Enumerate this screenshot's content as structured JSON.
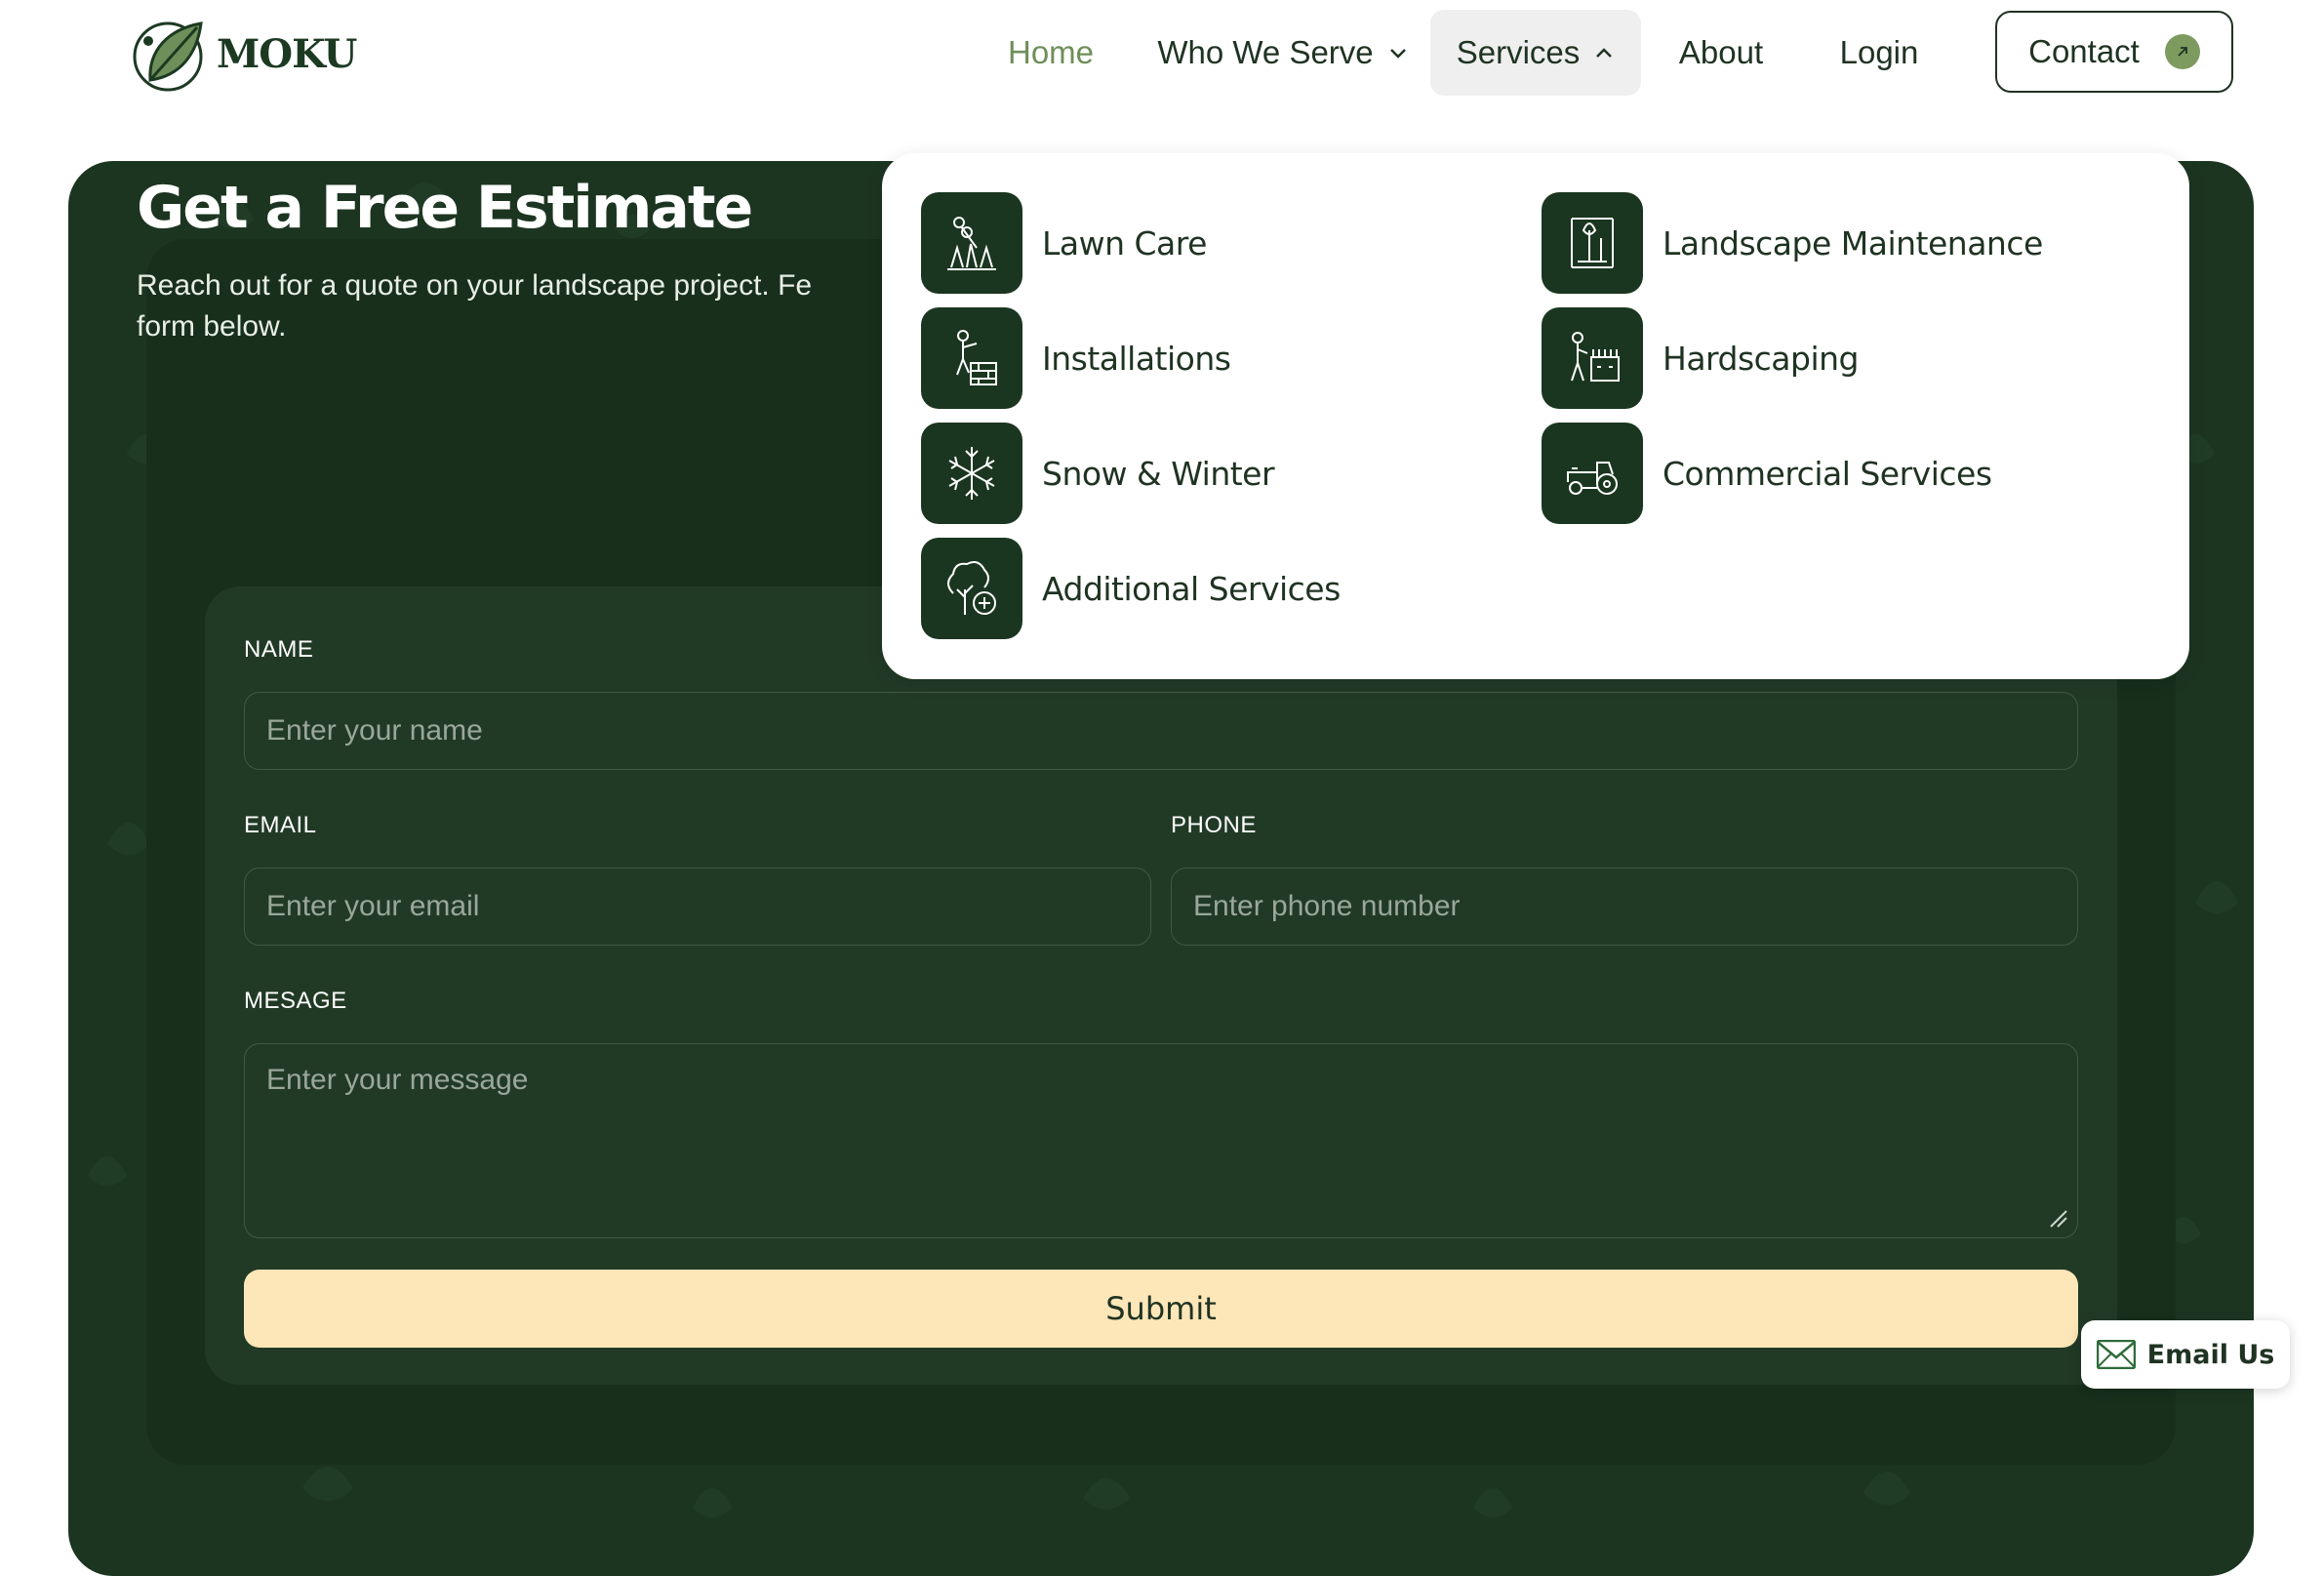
{
  "brand": {
    "name": "MOKU"
  },
  "nav": {
    "home": "Home",
    "who_we_serve": "Who We Serve",
    "services": "Services",
    "about": "About",
    "login": "Login",
    "contact": "Contact"
  },
  "services_menu": {
    "items": [
      {
        "label": "Lawn Care",
        "icon": "lawn-care-icon"
      },
      {
        "label": "Landscape Maintenance",
        "icon": "landscape-maintenance-icon"
      },
      {
        "label": "Installations",
        "icon": "installations-icon"
      },
      {
        "label": "Hardscaping",
        "icon": "hardscaping-icon"
      },
      {
        "label": "Snow & Winter",
        "icon": "snowflake-icon"
      },
      {
        "label": "Commercial Services",
        "icon": "tractor-icon"
      },
      {
        "label": "Additional Services",
        "icon": "tree-plus-icon"
      }
    ]
  },
  "estimate": {
    "title": "Get a Free Estimate",
    "subtitle": "Reach out for a quote on your landscape project. Fe",
    "subtitle_line2": "form below."
  },
  "form": {
    "name_label": "NAME",
    "name_placeholder": "Enter your name",
    "email_label": "EMAIL",
    "email_placeholder": "Enter your email",
    "phone_label": "PHONE",
    "phone_placeholder": "Enter phone number",
    "message_label": "MESAGE",
    "message_placeholder": "Enter your message",
    "submit_label": "Submit"
  },
  "email_us": {
    "label": "Email Us",
    "icon": "envelope-icon"
  },
  "colors": {
    "dark_green": "#1c3521",
    "accent_green": "#6e8f59",
    "submit_bg": "#fde6b8",
    "icon_tile": "#1b3620"
  }
}
